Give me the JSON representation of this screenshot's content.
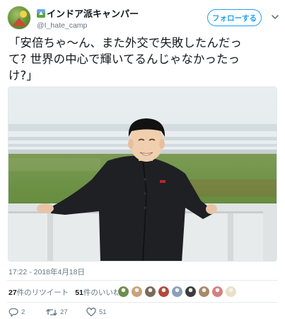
{
  "user": {
    "display_name": "インドア派キャンパー",
    "handle": "@I_hate_camp",
    "avatar_icon": "avatar-camping-icon",
    "flag_icon": "camping-flag-icon"
  },
  "follow_button": {
    "label": "フォローする"
  },
  "menu_icon": "chevron-down-icon",
  "tweet": {
    "text_lines": [
      "「安倍ちゃ～ん、また外交で失敗したんだっ",
      "て? 世界の中心で輝いてるんじゃなかったっ",
      "け?」"
    ]
  },
  "photo": {
    "icon": "photo-man-seated-on-balcony"
  },
  "timestamp": "17:22 - 2018年4月18日",
  "stats": {
    "retweets_count": "27",
    "retweets_label": "件のリツイート",
    "likes_count": "51",
    "likes_label": "件のいいね"
  },
  "likers": {
    "count": 9,
    "colors": [
      "#6b8e4e",
      "#c9a27a",
      "#7a6a5a",
      "#b04a3a",
      "#8aa0b8",
      "#3c3c3c",
      "#a88a6a",
      "#d67f7f",
      "#eae0c8"
    ]
  },
  "actions": {
    "reply_count": "2",
    "retweet_count": "27",
    "like_count": "51",
    "reply_icon": "reply-icon",
    "retweet_icon": "retweet-icon",
    "like_icon": "heart-icon"
  },
  "colors": {
    "accent": "#1da1f2",
    "text": "#14171a",
    "secondary": "#657786",
    "border": "#e6ecf0"
  }
}
